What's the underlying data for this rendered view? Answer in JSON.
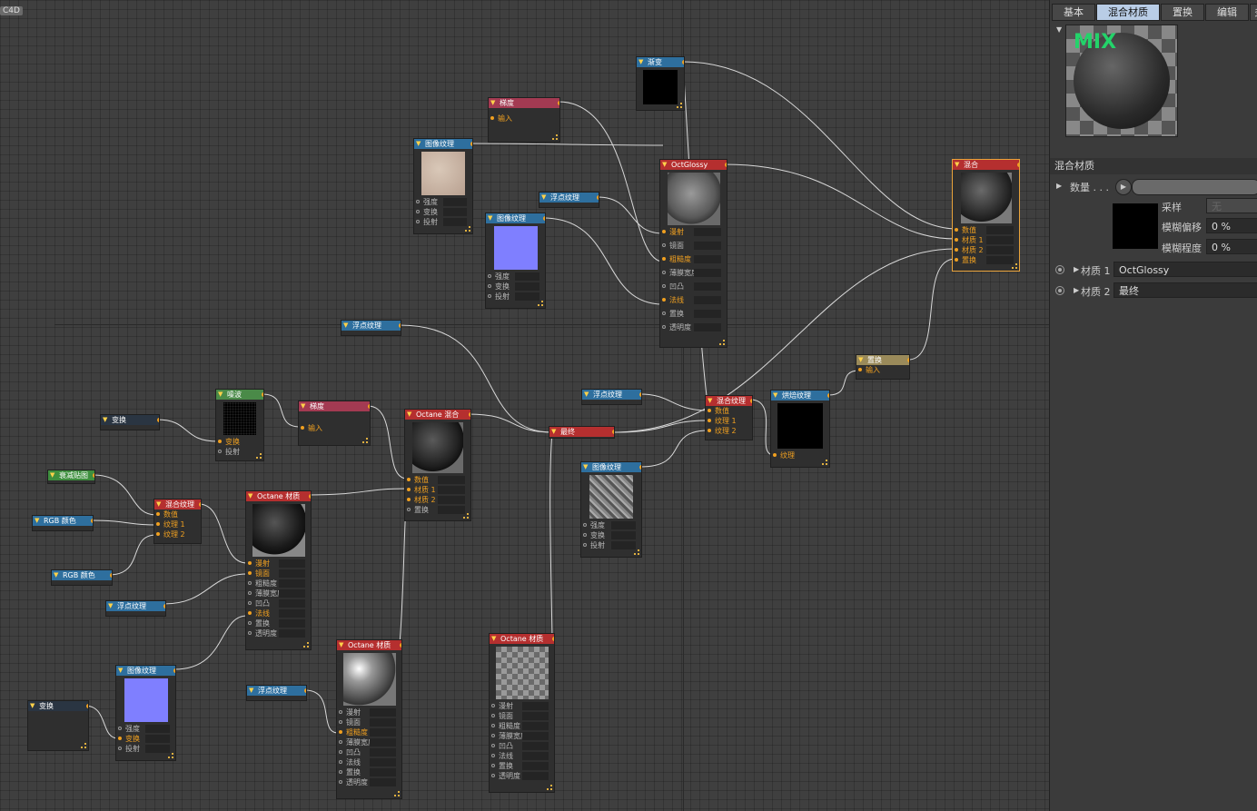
{
  "app": {
    "badge": "C4D"
  },
  "panel": {
    "tabs": [
      "基本",
      "混合材质",
      "置换",
      "编辑",
      "多"
    ],
    "preview_text": "MIX",
    "section_title": "混合材质",
    "amount_label": "数量 . . .",
    "sample_label": "采样",
    "sample_value": "无",
    "blur_offset_label": "模糊偏移",
    "blur_offset_value": "0 %",
    "blur_degree_label": "模糊程度",
    "blur_degree_value": "0 %",
    "material1_label": "材质 1",
    "material1_value": "OctGlossy",
    "material2_label": "材质 2",
    "material2_value": "最终"
  },
  "nodes": {
    "gradient_top": {
      "title": "渐变"
    },
    "grad1": {
      "title": "梯度",
      "ports": [
        "输入"
      ]
    },
    "img1": {
      "title": "图像纹理",
      "ports": [
        "强度",
        "变换",
        "投射"
      ]
    },
    "float1": {
      "title": "浮点纹理"
    },
    "img2": {
      "title": "图像纹理",
      "ports": [
        "强度",
        "变换",
        "投射"
      ]
    },
    "octglossy": {
      "title": "OctGlossy",
      "ports": [
        "漫射",
        "镜面",
        "粗糙度",
        "薄膜宽度",
        "凹凸",
        "法线",
        "置换",
        "透明度"
      ]
    },
    "mix_top": {
      "title": "混合",
      "ports": [
        "数值",
        "材质 1",
        "材质 2",
        "置换"
      ]
    },
    "float2": {
      "title": "浮点纹理"
    },
    "disp": {
      "title": "置换",
      "ports": [
        "输入"
      ]
    },
    "noise": {
      "title": "噪波",
      "ports": [
        "变换",
        "投射"
      ]
    },
    "xform1": {
      "title": "变换"
    },
    "grad2": {
      "title": "梯度",
      "ports": [
        "输入"
      ]
    },
    "octmix": {
      "title": "Octane 混合",
      "ports": [
        "数值",
        "材质 1",
        "材质 2",
        "置换"
      ]
    },
    "final": {
      "title": "最终"
    },
    "float3": {
      "title": "浮点纹理"
    },
    "mixtex2": {
      "title": "混合纹理",
      "ports": [
        "数值",
        "纹理 1",
        "纹理 2"
      ]
    },
    "bake": {
      "title": "烘焙纹理",
      "ports": [
        "纹理"
      ]
    },
    "img3": {
      "title": "图像纹理",
      "ports": [
        "强度",
        "变换",
        "投射"
      ]
    },
    "falloff": {
      "title": "衰减贴图"
    },
    "rgb1": {
      "title": "RGB 颜色"
    },
    "rgb2": {
      "title": "RGB 颜色"
    },
    "mixtex1": {
      "title": "混合纹理",
      "ports": [
        "数值",
        "纹理 1",
        "纹理 2"
      ]
    },
    "octmat1": {
      "title": "Octane 材质",
      "ports": [
        "漫射",
        "镜面",
        "粗糙度",
        "薄膜宽度",
        "凹凸",
        "法线",
        "置换",
        "透明度"
      ]
    },
    "float4": {
      "title": "浮点纹理"
    },
    "img4": {
      "title": "图像纹理",
      "ports": [
        "强度",
        "变换",
        "投射"
      ]
    },
    "xform2": {
      "title": "变换"
    },
    "float5": {
      "title": "浮点纹理"
    },
    "octmat2": {
      "title": "Octane 材质",
      "ports": [
        "漫射",
        "镜面",
        "粗糙度",
        "薄膜宽度",
        "凹凸",
        "法线",
        "置换",
        "透明度"
      ]
    },
    "octmat3": {
      "title": "Octane 材质",
      "ports": [
        "漫射",
        "镜面",
        "粗糙度",
        "薄膜宽度",
        "凹凸",
        "法线",
        "置换",
        "透明度"
      ]
    }
  }
}
